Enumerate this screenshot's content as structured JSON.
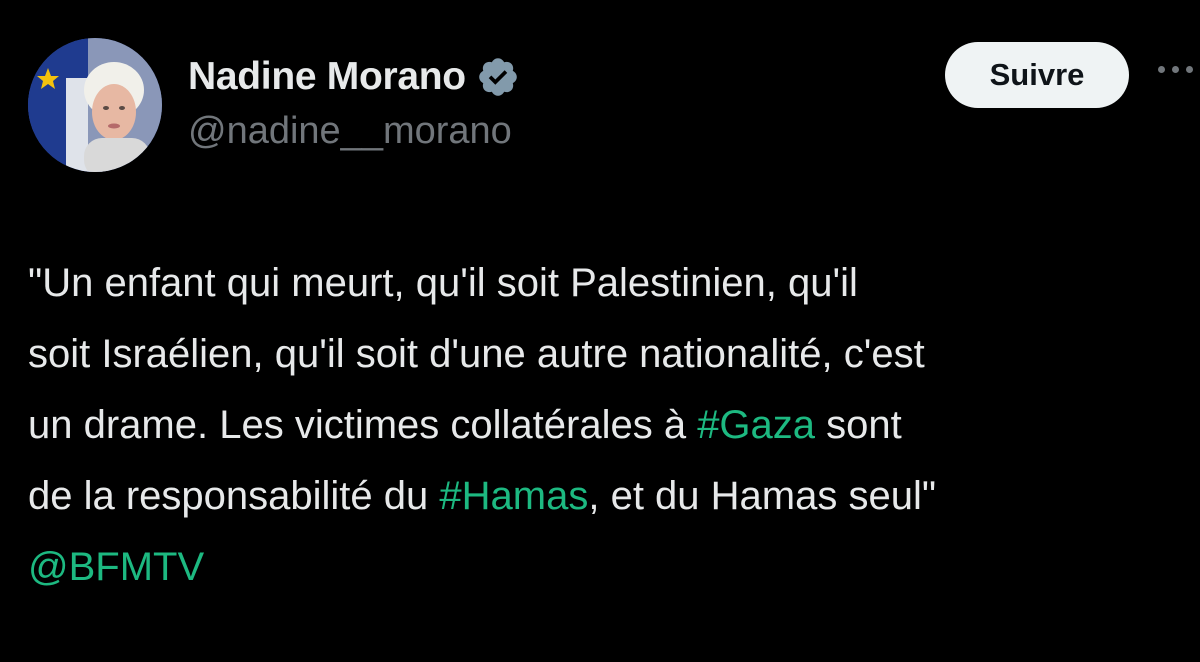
{
  "header": {
    "display_name": "Nadine Morano",
    "handle": "@nadine__morano",
    "follow_label": "Suivre",
    "verified": true
  },
  "icons": {
    "verified": "verified-badge-icon",
    "more": "more-options-icon"
  },
  "tweet": {
    "line1": "\"Un enfant qui meurt, qu'il soit Palestinien, qu'il",
    "line2": "soit Israélien, qu'il soit d'une autre nationalité, c'est",
    "line3_pre": "un drame. Les victimes collatérales à ",
    "hashtag_gaza": "#Gaza",
    "line3_post": " sont",
    "line4_pre": "de la responsabilité du ",
    "hashtag_hamas": "#Hamas",
    "line4_post": ", et du Hamas seul\"",
    "mention": "@BFMTV"
  },
  "colors": {
    "background": "#000000",
    "text": "#e7e9ea",
    "secondary": "#71767b",
    "link": "#1db981",
    "button_bg": "#eff3f4"
  }
}
